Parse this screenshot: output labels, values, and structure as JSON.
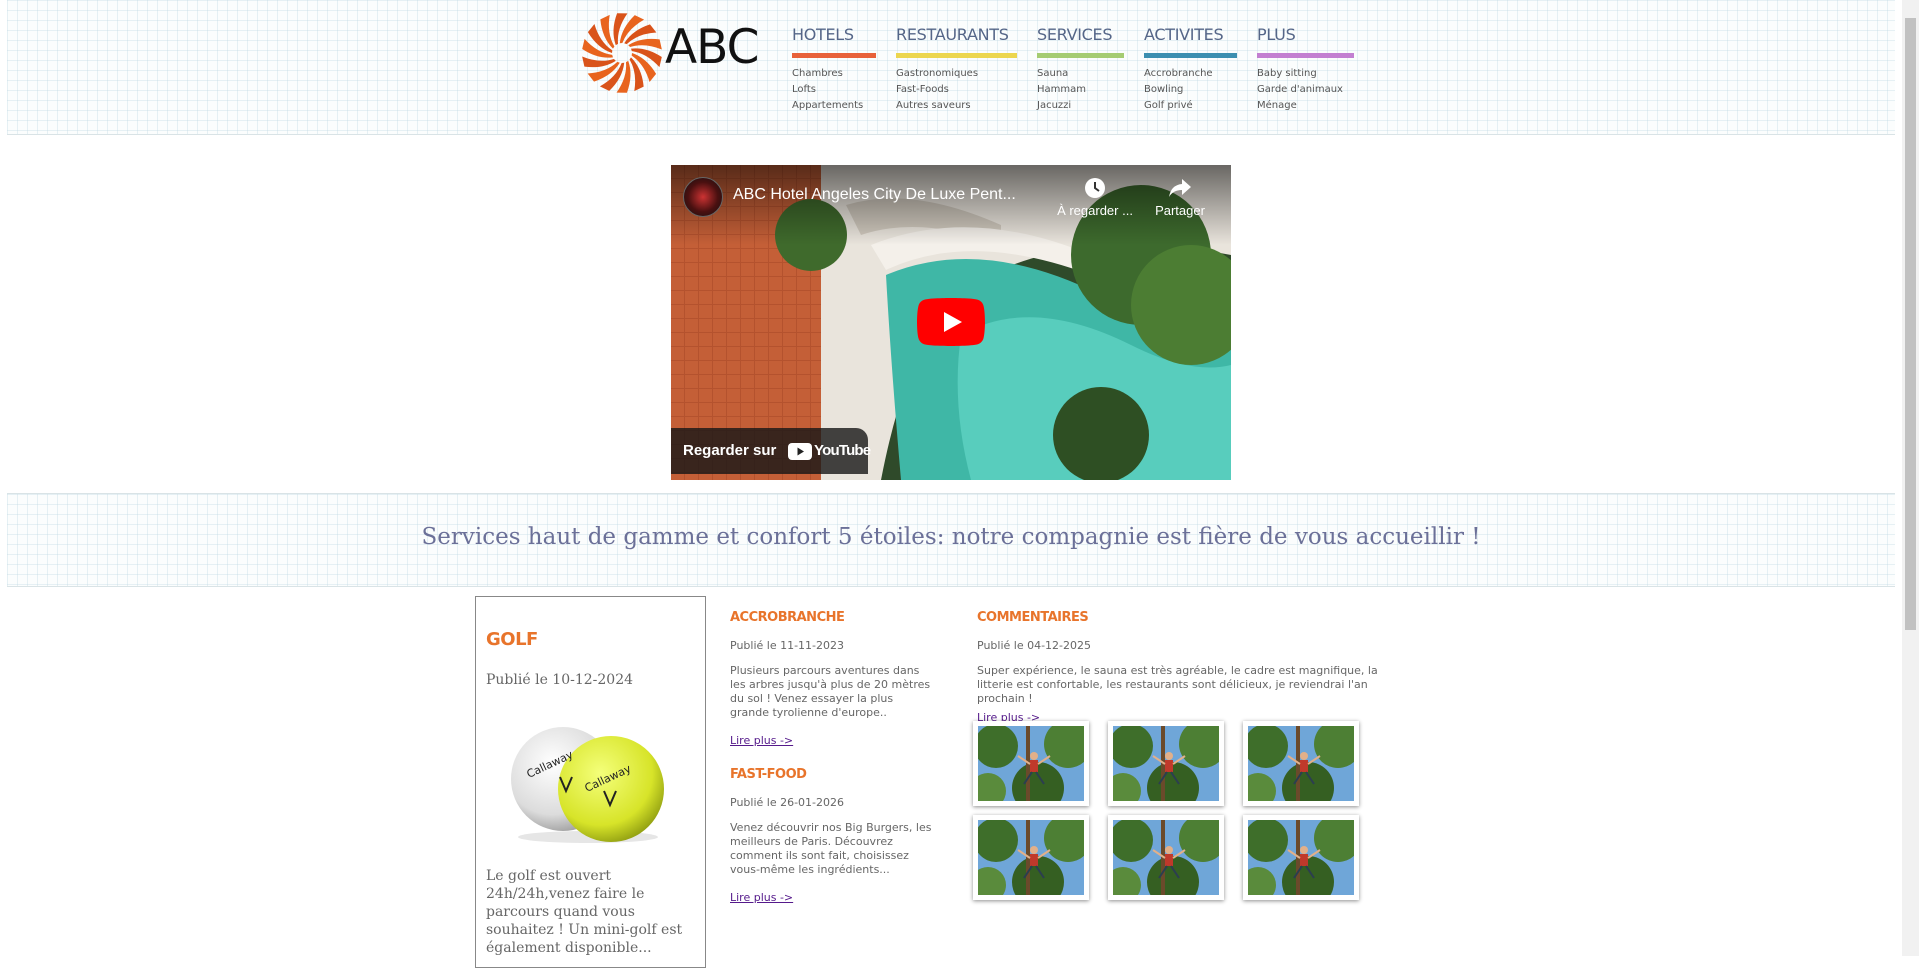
{
  "brand": {
    "name": "ABC",
    "logo_colors": [
      "#e8641e",
      "#d9531a"
    ]
  },
  "nav": [
    {
      "label": "HOTELS",
      "color": "#e8613a",
      "items": [
        "Chambres",
        "Lofts",
        "Appartements"
      ]
    },
    {
      "label": "RESTAURANTS",
      "color": "#ecd64f",
      "items": [
        "Gastronomiques",
        "Fast-Foods",
        "Autres saveurs"
      ]
    },
    {
      "label": "SERVICES",
      "color": "#a5cc72",
      "items": [
        "Sauna",
        "Hammam",
        "Jacuzzi"
      ]
    },
    {
      "label": "ACTIVITES",
      "color": "#3c8fb0",
      "items": [
        "Accrobranche",
        "Bowling",
        "Golf privé"
      ]
    },
    {
      "label": "PLUS",
      "color": "#c37fd1",
      "items": [
        "Baby sitting",
        "Garde d'animaux",
        "Ménage"
      ]
    }
  ],
  "video": {
    "title": "ABC Hotel Angeles City De Luxe Pent...",
    "watch_later": "À regarder ...",
    "share": "Partager",
    "watch_on": "Regarder sur",
    "platform": "YouTube"
  },
  "slogan": "Services haut de gamme et confort 5 étoiles: notre compagnie est fière de vous accueillir !",
  "golf": {
    "title": "GOLF",
    "published": "Publié le 10-12-2024",
    "text": "Le golf est ouvert 24h/24h,venez faire le parcours quand vous souhaitez ! Un mini-golf est également disponible..."
  },
  "articles": [
    {
      "title": "ACCROBRANCHE",
      "published": "Publié le 11-11-2023",
      "text": "Plusieurs parcours aventures dans les arbres jusqu'à plus de 20 mètres du sol ! Venez essayer la plus grande tyrolienne d'europe..",
      "link": "Lire plus ->"
    },
    {
      "title": "FAST-FOOD",
      "published": "Publié le 26-01-2026",
      "text": "Venez découvrir nos Big Burgers, les meilleurs de Paris. Découvrez comment ils sont fait, choisissez vous-même les ingrédients...",
      "link": "Lire plus ->"
    }
  ],
  "comments": {
    "title": "COMMENTAIRES",
    "published": "Publié le 04-12-2025",
    "text": "Super expérience, le sauna est très agréable, le cadre est magnifique, la litterie est confortable, les restaurants sont délicieux, je reviendrai l'an prochain !",
    "link": "Lire plus ->"
  },
  "accent_color": "#e8742b"
}
